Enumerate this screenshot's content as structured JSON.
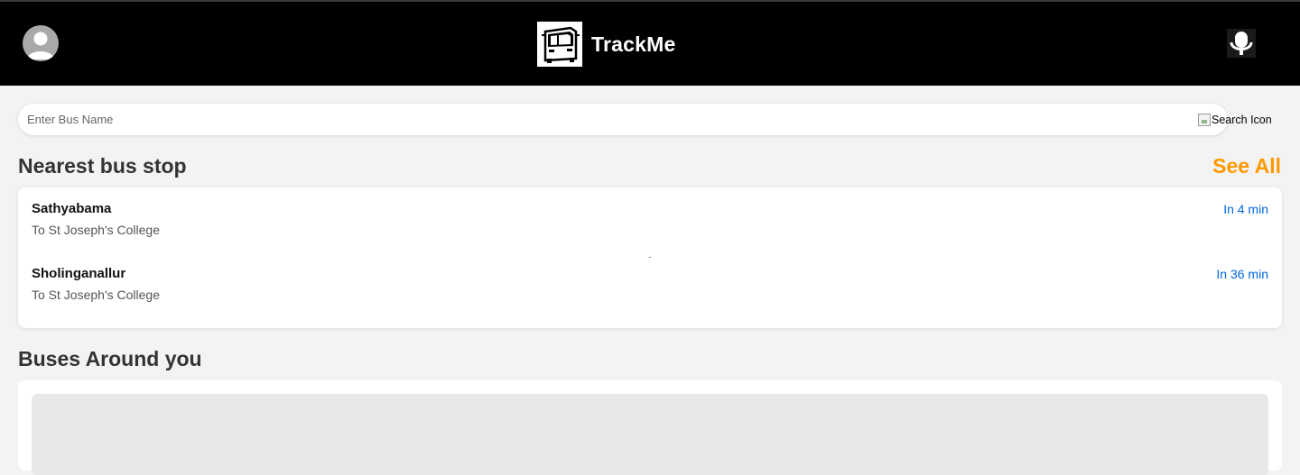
{
  "header": {
    "title": "TrackMe",
    "avatar_icon": "user-avatar-icon",
    "logo_icon": "bus-logo-icon",
    "mic_icon": "microphone-icon"
  },
  "search": {
    "placeholder": "Enter Bus Name",
    "icon_alt": "Search Icon"
  },
  "nearest": {
    "title": "Nearest bus stop",
    "see_all": "See All",
    "stops": [
      {
        "name": "Sathyabama",
        "destination": "To St Joseph's College",
        "eta": "In 4 min"
      },
      {
        "name": "Sholinganallur",
        "destination": "To St Joseph's College",
        "eta": "In 36 min"
      }
    ]
  },
  "around": {
    "title": "Buses Around you"
  },
  "colors": {
    "header_bg": "#000000",
    "page_bg": "#f3f3f3",
    "accent": "#ff9900",
    "eta": "#0066dd",
    "map_placeholder": "#e8e8ea"
  }
}
